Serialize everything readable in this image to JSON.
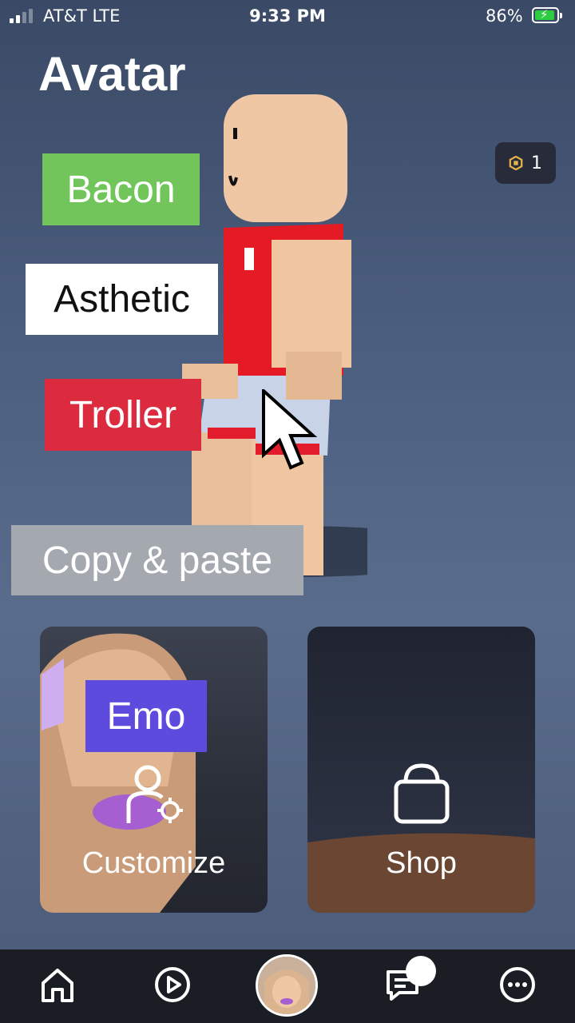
{
  "status_bar": {
    "carrier": "AT&T  LTE",
    "time": "9:33 PM",
    "battery_percent": "86%"
  },
  "page": {
    "title": "Avatar"
  },
  "robux": {
    "count": "1"
  },
  "tags": {
    "bacon": "Bacon",
    "asthetic": "Asthetic",
    "troller": "Troller",
    "copy_paste": "Copy & paste",
    "emo": "Emo"
  },
  "cards": {
    "customize": {
      "label": "Customize",
      "icon": "person-gear-icon"
    },
    "shop": {
      "label": "Shop",
      "icon": "shopping-bag-icon"
    }
  },
  "nav": {
    "items": [
      {
        "icon": "home-icon"
      },
      {
        "icon": "play-icon"
      },
      {
        "icon": "avatar-icon"
      },
      {
        "icon": "chat-icon"
      },
      {
        "icon": "more-icon"
      }
    ]
  },
  "colors": {
    "bacon": "#72c55b",
    "troller": "#dc2b3f",
    "emo": "#5c4bdc",
    "copy_paste": "#a4a9b0",
    "nav_bg": "#1b1d24"
  }
}
